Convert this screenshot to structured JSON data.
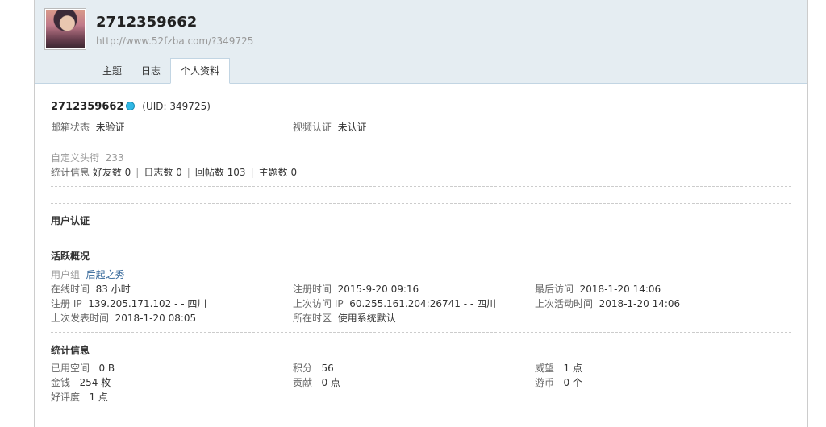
{
  "header": {
    "username": "2712359662",
    "url": "http://www.52fzba.com/?349725",
    "tabs": [
      "主题",
      "日志",
      "个人资料"
    ]
  },
  "profile": {
    "name": "2712359662",
    "uid": "(UID: 349725)",
    "email_label": "邮箱状态",
    "email_value": "未验证",
    "video_label": "视频认证",
    "video_value": "未认证",
    "custom_title_label": "自定义头衔",
    "custom_title_value": "233",
    "stats_label": "统计信息",
    "stats": [
      "好友数 0",
      "日志数 0",
      "回帖数 103",
      "主题数 0"
    ]
  },
  "user_verify": {
    "title": "用户认证"
  },
  "activity": {
    "title": "活跃概况",
    "group_label": "用户组",
    "group_value": "后起之秀",
    "online_time_label": "在线时间",
    "online_time_value": "83 小时",
    "reg_time_label": "注册时间",
    "reg_time_value": "2015-9-20 09:16",
    "last_visit_label": "最后访问",
    "last_visit_value": "2018-1-20 14:06",
    "reg_ip_label": "注册 IP",
    "reg_ip_value": "139.205.171.102 - - 四川",
    "last_ip_label": "上次访问 IP",
    "last_ip_value": "60.255.161.204:26741 - - 四川",
    "last_active_label": "上次活动时间",
    "last_active_value": "2018-1-20 14:06",
    "last_post_label": "上次发表时间",
    "last_post_value": "2018-1-20 08:05",
    "timezone_label": "所在时区",
    "timezone_value": "使用系统默认"
  },
  "statistics": {
    "title": "统计信息",
    "space_label": "已用空间",
    "space_value": "0 B",
    "points_label": "积分",
    "points_value": "56",
    "prestige_label": "威望",
    "prestige_value": "1 点",
    "money_label": "金钱",
    "money_value": "254 枚",
    "contrib_label": "贡献",
    "contrib_value": "0 点",
    "coins_label": "游币",
    "coins_value": "0 个",
    "rating_label": "好评度",
    "rating_value": "1 点"
  }
}
